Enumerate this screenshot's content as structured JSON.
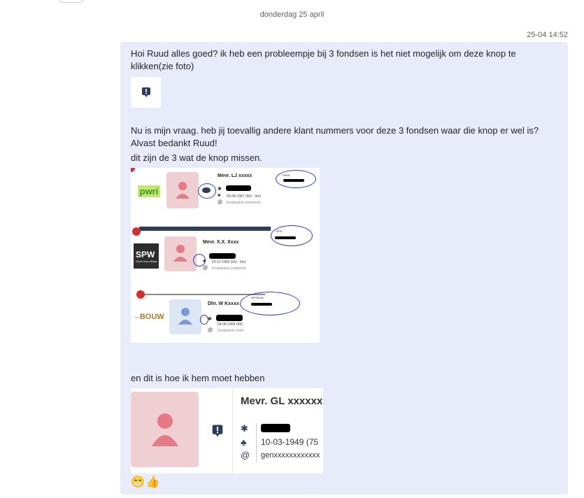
{
  "header": {
    "day_divider": "donderdag 25 april"
  },
  "message": {
    "timestamp": "25-04 14:52",
    "text1": "Hoi Ruud alles goed? ik heb een probleempje bij 3 fondsen is het niet mogelijk om deze knop te klikken(zie foto)",
    "text2": " Nu is mijn vraag. heb jij toevallig andere klant nummers voor deze 3 fondsen waar die knop er wel is? Alvast bedankt Ruud!",
    "text3": "dit zijn de 3 wat de knop missen.",
    "text4": "en dit is hoe ik hem moet hebben",
    "reactions": [
      "😁",
      "👍"
    ]
  },
  "screenshot1": {
    "cards": [
      {
        "logo": "pwri",
        "name": "Mevr. LJ xxxxx",
        "fund": "PWRI",
        "birth": "05-08-1967 (56) - 9m)",
        "email": "Emailadres onbekend"
      },
      {
        "logo": "SPW",
        "logo_sub": "Goed voor elkaar.",
        "name": "Mevr. X.X. Xxxx",
        "fund": "SPW",
        "birth": "20-11-1969 (54) - 5m)",
        "email": "Emailadres onbekend"
      },
      {
        "logo": "BOUW",
        "logo_prefix": "bpf",
        "name": "Dhr. W Kxxxx",
        "fund": "BPFBouw",
        "birth": "04-08-1954 (69)",
        "email": "Emailadres onbe"
      }
    ]
  },
  "screenshot2": {
    "name": "Mevr. GL xxxxxx",
    "birth": "10-03-1949 (75",
    "email": "genxxxxxxxxxxxx"
  },
  "colors": {
    "bubble": "#e8ebfa",
    "accent": "#2f3ec7",
    "dark_navy": "#2d3d5a",
    "avatar_pink": "#f0cfd3",
    "avatar_blue": "#dde6f5"
  }
}
